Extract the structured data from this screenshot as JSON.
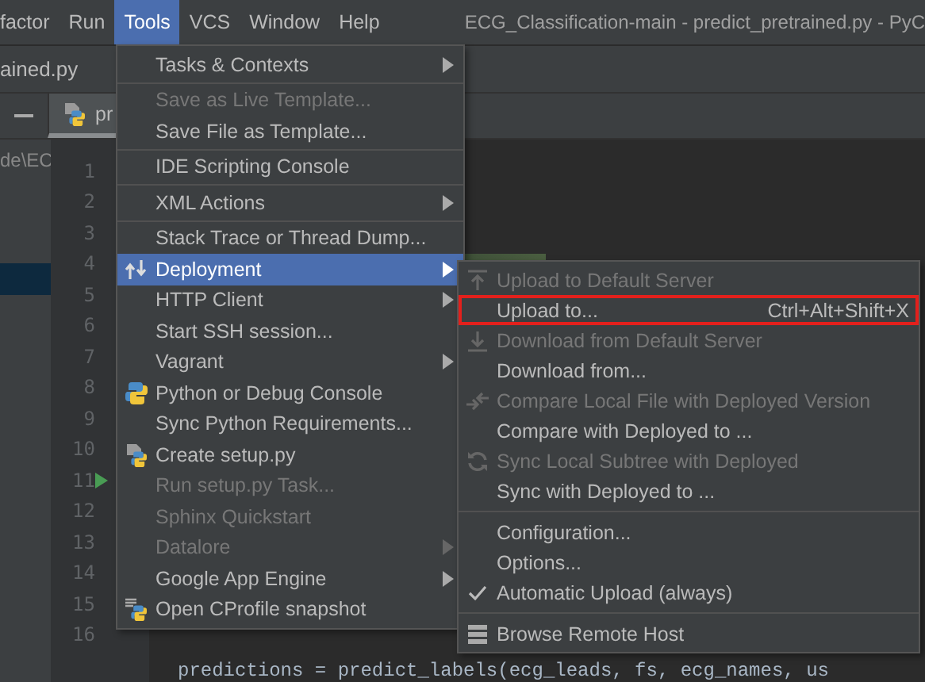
{
  "menu_bar": {
    "items": [
      {
        "label": "factor",
        "selected": false
      },
      {
        "label": "Run",
        "selected": false
      },
      {
        "label": "Tools",
        "selected": true
      },
      {
        "label": "VCS",
        "selected": false
      },
      {
        "label": "Window",
        "selected": false
      },
      {
        "label": "Help",
        "selected": false
      }
    ],
    "title": "ECG_Classification-main - predict_pretrained.py - PyC"
  },
  "navigation_bar": {
    "file": "ained.py"
  },
  "editor_tabs": [
    {
      "label": "pr",
      "selected": true
    }
  ],
  "project_panel": {
    "path": "de\\EC"
  },
  "editor": {
    "lines": [
      {
        "number": "1",
        "run_marker": false
      },
      {
        "number": "2",
        "run_marker": false
      },
      {
        "number": "3",
        "run_marker": false
      },
      {
        "number": "4",
        "run_marker": false
      },
      {
        "number": "5",
        "run_marker": false
      },
      {
        "number": "6",
        "run_marker": false
      },
      {
        "number": "7",
        "run_marker": false
      },
      {
        "number": "8",
        "run_marker": false
      },
      {
        "number": "9",
        "run_marker": false
      },
      {
        "number": "10",
        "run_marker": false
      },
      {
        "number": "11",
        "run_marker": true
      },
      {
        "number": "12",
        "run_marker": false
      },
      {
        "number": "13",
        "run_marker": false
      },
      {
        "number": "14",
        "run_marker": false
      },
      {
        "number": "15",
        "run_marker": false
      },
      {
        "number": "16",
        "run_marker": false
      }
    ],
    "code_line": "predictions = predict_labels(ecg_leads, fs, ecg_names, us"
  },
  "tools_menu": [
    {
      "kind": "item",
      "label": "Tasks & Contexts",
      "disabled": false,
      "submenu": true,
      "selected": false
    },
    {
      "kind": "separator"
    },
    {
      "kind": "item",
      "label": "Save as Live Template...",
      "disabled": true,
      "submenu": false,
      "selected": false
    },
    {
      "kind": "item",
      "label": "Save File as Template...",
      "disabled": false,
      "submenu": false,
      "selected": false
    },
    {
      "kind": "separator"
    },
    {
      "kind": "item",
      "label": "IDE Scripting Console",
      "disabled": false,
      "submenu": false,
      "selected": false
    },
    {
      "kind": "separator"
    },
    {
      "kind": "item",
      "label": "XML Actions",
      "disabled": false,
      "submenu": true,
      "selected": false
    },
    {
      "kind": "separator"
    },
    {
      "kind": "item",
      "label": "Stack Trace or Thread Dump...",
      "disabled": false,
      "submenu": false,
      "selected": false
    },
    {
      "kind": "deploy",
      "label": "Deployment",
      "disabled": false,
      "submenu": true,
      "selected": true
    },
    {
      "kind": "item",
      "label": "HTTP Client",
      "disabled": false,
      "submenu": true,
      "selected": false
    },
    {
      "kind": "item",
      "label": "Start SSH session...",
      "disabled": false,
      "submenu": false,
      "selected": false
    },
    {
      "kind": "item",
      "label": "Vagrant",
      "disabled": false,
      "submenu": true,
      "selected": false
    },
    {
      "kind": "python",
      "label": "Python or Debug Console",
      "disabled": false,
      "submenu": false,
      "selected": false
    },
    {
      "kind": "item",
      "label": "Sync Python Requirements...",
      "disabled": false,
      "submenu": false,
      "selected": false
    },
    {
      "kind": "python-file",
      "label": "Create setup.py",
      "disabled": false,
      "submenu": false,
      "selected": false
    },
    {
      "kind": "item",
      "label": "Run setup.py Task...",
      "disabled": true,
      "submenu": false,
      "selected": false
    },
    {
      "kind": "item",
      "label": "Sphinx Quickstart",
      "disabled": true,
      "submenu": false,
      "selected": false
    },
    {
      "kind": "item",
      "label": "Datalore",
      "disabled": true,
      "submenu": true,
      "selected": false
    },
    {
      "kind": "item",
      "label": "Google App Engine",
      "disabled": false,
      "submenu": true,
      "selected": false
    },
    {
      "kind": "profile",
      "label": "Open CProfile snapshot",
      "disabled": false,
      "submenu": false,
      "selected": false
    }
  ],
  "deployment_menu": [
    {
      "kind": "upload",
      "label": "Upload to Default Server",
      "disabled": true,
      "checked": false,
      "outlined": false
    },
    {
      "kind": "item",
      "label": "Upload to...",
      "shortcut": "Ctrl+Alt+Shift+X",
      "disabled": false,
      "checked": false,
      "outlined": true
    },
    {
      "kind": "download",
      "label": "Download from Default Server",
      "disabled": true,
      "checked": false,
      "outlined": false
    },
    {
      "kind": "item",
      "label": "Download from...",
      "disabled": false,
      "checked": false,
      "outlined": false
    },
    {
      "kind": "compare",
      "label": "Compare Local File with Deployed Version",
      "disabled": true,
      "checked": false,
      "outlined": false
    },
    {
      "kind": "item",
      "label": "Compare with Deployed to ...",
      "disabled": false,
      "checked": false,
      "outlined": false
    },
    {
      "kind": "sync",
      "label": "Sync Local Subtree with Deployed",
      "disabled": true,
      "checked": false,
      "outlined": false
    },
    {
      "kind": "item",
      "label": "Sync with Deployed to ...",
      "disabled": false,
      "checked": false,
      "outlined": false
    },
    {
      "kind": "separator"
    },
    {
      "kind": "item",
      "label": "Configuration...",
      "disabled": false,
      "checked": false,
      "outlined": false
    },
    {
      "kind": "item",
      "label": "Options...",
      "disabled": false,
      "checked": false,
      "outlined": false
    },
    {
      "kind": "item",
      "label": "Automatic Upload (always)",
      "disabled": false,
      "checked": true,
      "outlined": false
    },
    {
      "kind": "separator"
    },
    {
      "kind": "list",
      "label": "Browse Remote Host",
      "disabled": false,
      "checked": false,
      "outlined": false
    }
  ]
}
